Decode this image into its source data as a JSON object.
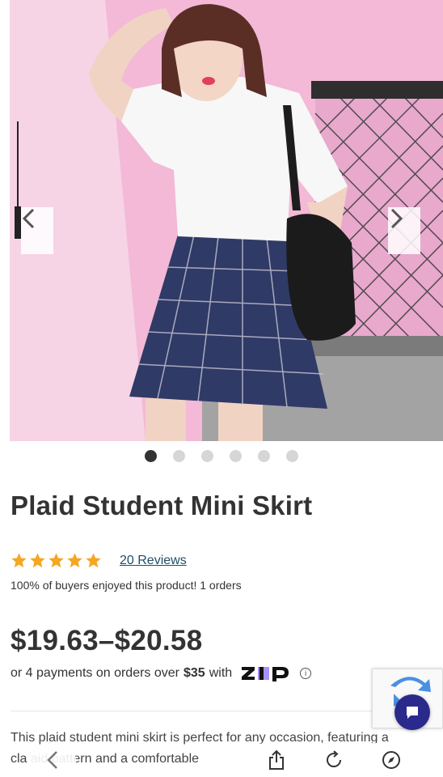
{
  "product": {
    "image_description_icon": "product-photo",
    "title": "Plaid Student Mini Skirt",
    "rating_stars": 5,
    "reviews_label": "20 Reviews",
    "buyers_text": "100% of buyers enjoyed this product! 1 orders",
    "price": "$19.63–$20.58",
    "payment": {
      "prefix": "or 4 payments on orders over",
      "amount": "$35",
      "suffix": "with",
      "provider_logo": "zip-logo"
    },
    "description": "This plaid student mini skirt is perfect for any occasion, featuring a",
    "description_line2": "cla    aid pattern and a comfortable"
  },
  "carousel": {
    "total_dots": 6,
    "active_index": 0,
    "prev_icon": "chevron-left-icon",
    "next_icon": "chevron-right-icon"
  },
  "colors": {
    "star": "#f5a623",
    "link": "#1f4e66",
    "chat": "#2a2a8c",
    "zip_purple": "#aa8fff"
  },
  "toolbar": {
    "back_icon": "chevron-left-icon",
    "share_icon": "share-icon",
    "reload_icon": "reload-icon",
    "compass_icon": "compass-icon"
  }
}
